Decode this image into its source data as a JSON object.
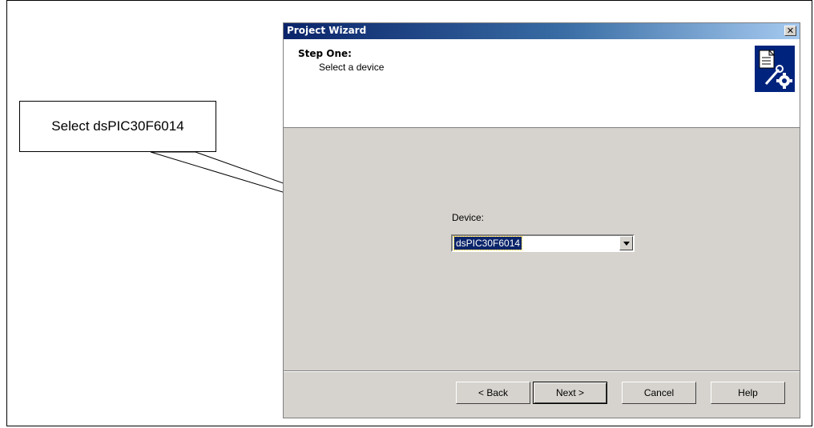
{
  "callout": {
    "text": "Select dsPIC30F6014"
  },
  "window": {
    "title": "Project Wizard",
    "close_glyph": "✕"
  },
  "header": {
    "step_title": "Step One:",
    "step_subtitle": "Select a device",
    "icon": "wizard-document-wrench-gear-icon"
  },
  "device": {
    "label": "Device:",
    "selected": "dsPIC30F6014"
  },
  "buttons": {
    "back": "< Back",
    "next": "Next >",
    "cancel": "Cancel",
    "help": "Help"
  },
  "colors": {
    "titlebar_start": "#0a246a",
    "titlebar_end": "#a6caf0",
    "dialog_bg": "#d6d3ce",
    "selection": "#0a246a"
  }
}
